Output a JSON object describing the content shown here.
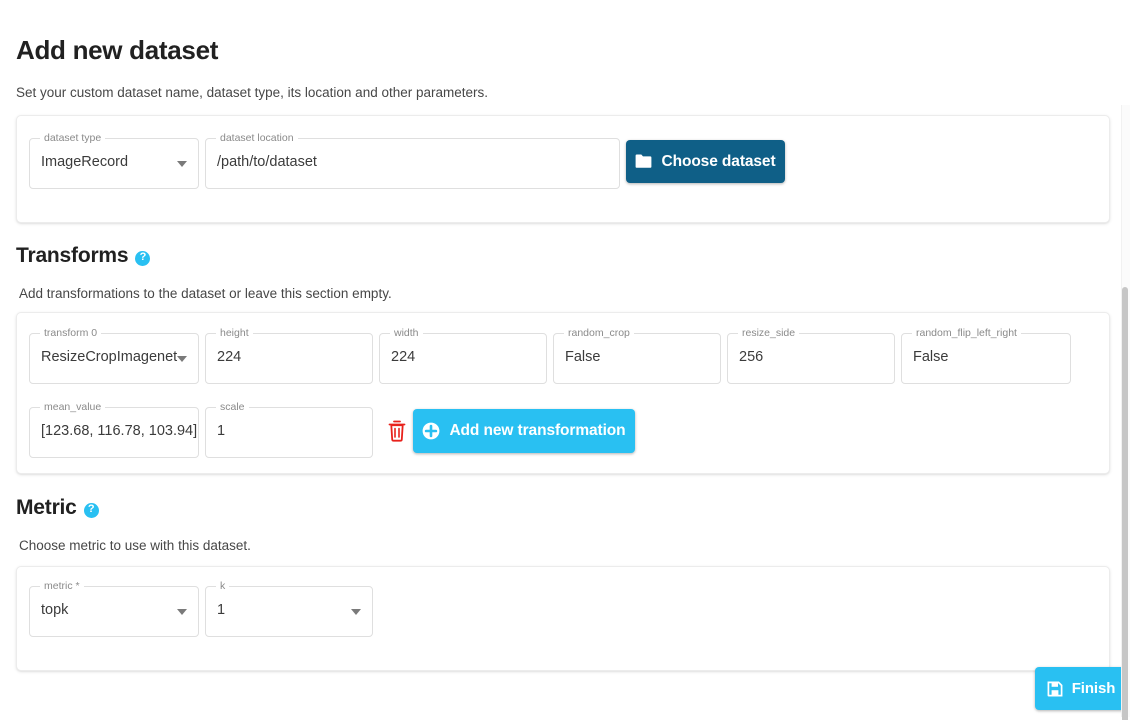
{
  "header": {
    "title": "Add new dataset",
    "subtitle": "Set your custom dataset name, dataset type, its location and other parameters."
  },
  "dataset_section": {
    "fields": [
      {
        "label": "dataset type",
        "value": "ImageRecord",
        "type": "select"
      },
      {
        "label": "dataset location",
        "value": "/path/to/dataset",
        "type": "text"
      }
    ],
    "choose_button": {
      "label": "Choose dataset",
      "icon": "folder-icon",
      "color": "#0f5f87"
    }
  },
  "transforms_section": {
    "heading": "Transforms",
    "help_icon": "help-circle-icon",
    "description": "Add transformations to the dataset or leave this section empty.",
    "fields": [
      {
        "label": "transform 0",
        "value": "ResizeCropImagenet",
        "type": "select"
      },
      {
        "label": "height",
        "value": "224",
        "type": "text"
      },
      {
        "label": "width",
        "value": "224",
        "type": "text"
      },
      {
        "label": "random_crop",
        "value": "False",
        "type": "text"
      },
      {
        "label": "resize_side",
        "value": "256",
        "type": "text"
      },
      {
        "label": "random_flip_left_right",
        "value": "False",
        "type": "text"
      },
      {
        "label": "mean_value",
        "value": "[123.68, 116.78, 103.94]",
        "type": "text"
      },
      {
        "label": "scale",
        "value": "1",
        "type": "text"
      }
    ],
    "delete_icon": "trash-icon",
    "add_button": {
      "label": "Add new transformation",
      "icon": "plus-circle-icon",
      "color": "#29c0f2"
    }
  },
  "metric_section": {
    "heading": "Metric",
    "help_icon": "help-circle-icon",
    "description": "Choose metric to use with this dataset.",
    "fields": [
      {
        "label": "metric *",
        "value": "topk",
        "type": "select"
      },
      {
        "label": "k",
        "value": "1",
        "type": "select"
      }
    ]
  },
  "footer": {
    "finish_button": {
      "label": "Finish",
      "icon": "save-icon",
      "color": "#29c0f2"
    }
  },
  "icons": {
    "help": "?"
  }
}
